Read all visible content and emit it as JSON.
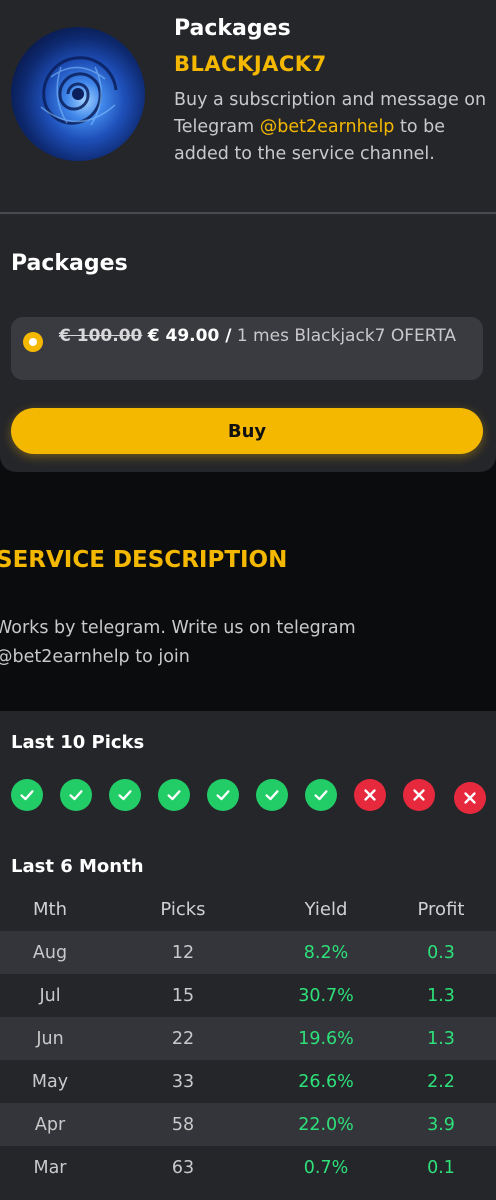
{
  "header": {
    "title": "Packages",
    "code": "BLACKJACK7",
    "desc_before": "Buy a subscription and message on Telegram ",
    "telegram_handle": "@bet2earnhelp",
    "desc_after": " to be added to the service channel."
  },
  "packages": {
    "title": "Packages",
    "option": {
      "old_price": "€ 100.00",
      "new_price": "€ 49.00 /",
      "description": " 1 mes Blackjack7 OFERTA",
      "selected": true
    },
    "buy_label": "Buy"
  },
  "service": {
    "title": "SERVICE DESCRIPTION",
    "description": "Works by telegram. Write us on telegram @bet2earnhelp to join"
  },
  "last_picks": {
    "title": "Last 10 Picks",
    "results": [
      "win",
      "win",
      "win",
      "win",
      "win",
      "win",
      "win",
      "loss",
      "loss",
      "loss"
    ]
  },
  "last_months": {
    "title": "Last 6 Month",
    "headers": [
      "Mth",
      "Picks",
      "Yield",
      "Profit"
    ],
    "rows": [
      {
        "mth": "Aug",
        "picks": "12",
        "yield": "8.2%",
        "profit": "0.3"
      },
      {
        "mth": "Jul",
        "picks": "15",
        "yield": "30.7%",
        "profit": "1.3"
      },
      {
        "mth": "Jun",
        "picks": "22",
        "yield": "19.6%",
        "profit": "1.3"
      },
      {
        "mth": "May",
        "picks": "33",
        "yield": "26.6%",
        "profit": "2.2"
      },
      {
        "mth": "Apr",
        "picks": "58",
        "yield": "22.0%",
        "profit": "3.9"
      },
      {
        "mth": "Mar",
        "picks": "63",
        "yield": "0.7%",
        "profit": "0.1"
      }
    ]
  },
  "colors": {
    "accent": "#f5b800",
    "win": "#22cc66",
    "loss": "#e6293d",
    "positive_text": "#2ee07a",
    "card": "#25262a",
    "background": "#0b0c0e"
  }
}
